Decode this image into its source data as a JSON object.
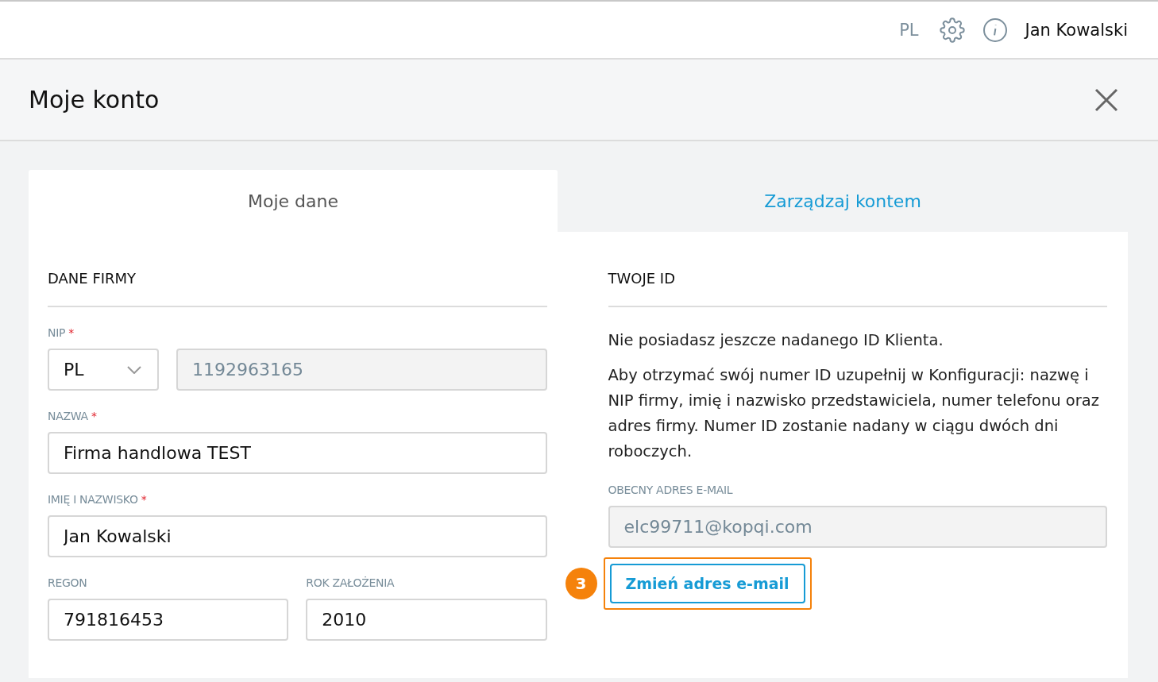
{
  "topbar": {
    "language": "PL",
    "user": "Jan Kowalski"
  },
  "dialog": {
    "title": "Moje konto"
  },
  "tabs": [
    {
      "label": "Moje dane",
      "selected": true
    },
    {
      "label": "Zarządzaj kontem",
      "selected": false
    }
  ],
  "required_mark": "*",
  "company": {
    "heading": "DANE FIRMY",
    "nip": {
      "label": "NIP",
      "required": true,
      "country": "PL",
      "value": "1192963165",
      "disabled": true
    },
    "fields": [
      {
        "label": "NAZWA",
        "required": true,
        "value": "Firma handlowa TEST",
        "disabled": false
      },
      {
        "label": "IMIĘ I NAZWISKO",
        "required": true,
        "value": "Jan Kowalski",
        "disabled": false
      }
    ],
    "pair": [
      {
        "label": "REGON",
        "required": false,
        "value": "791816453",
        "disabled": false
      },
      {
        "label": "ROK ZAŁOŻENIA",
        "required": false,
        "value": "2010",
        "disabled": false
      }
    ]
  },
  "your_id": {
    "heading": "TWOJE ID",
    "paragraphs": [
      "Nie posiadasz jeszcze nadanego ID Klienta.",
      "Aby otrzymać swój numer ID uzupełnij w Konfiguracji: nazwę i NIP firmy, imię i nazwisko przedstawiciela, numer telefonu oraz adres firmy. Numer ID zostanie nadany w ciągu dwóch dni roboczych."
    ],
    "email": {
      "label": "OBECNY ADRES E-MAIL",
      "required": false,
      "value": "elc99711@kopqi.com",
      "disabled": true
    },
    "button": {
      "label": "Zmień adres e-mail",
      "callout": "3"
    }
  }
}
